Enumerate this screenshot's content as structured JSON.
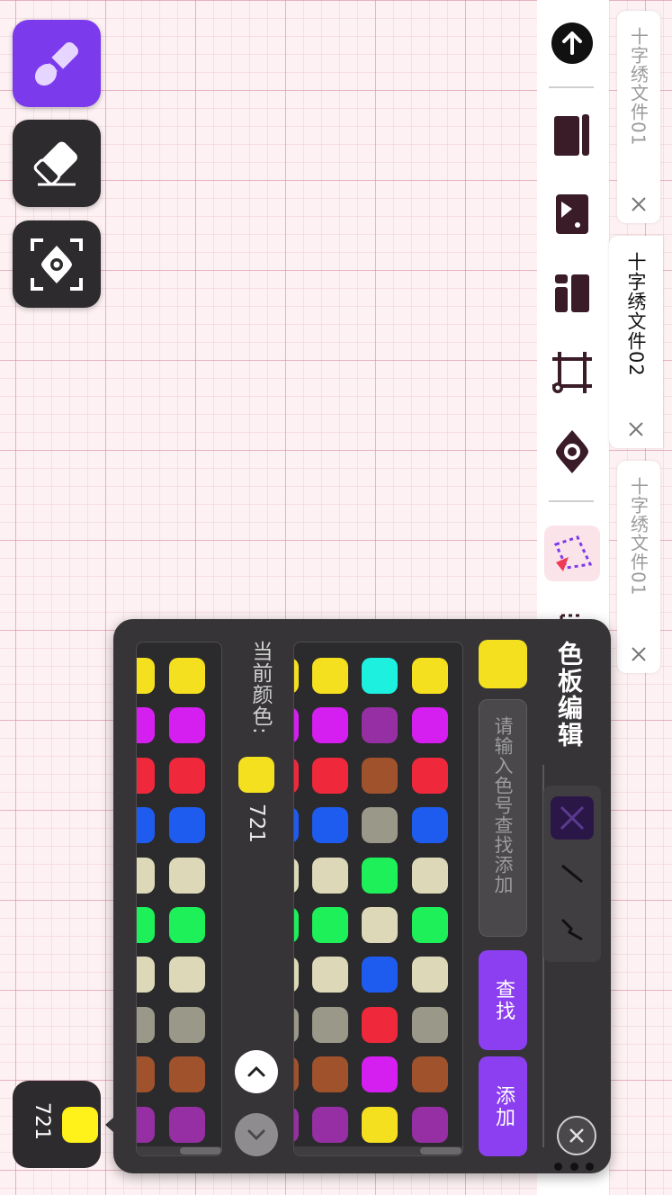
{
  "tabs": [
    {
      "label": "十字绣文件01",
      "active": false
    },
    {
      "label": "十字绣文件02",
      "active": true
    },
    {
      "label": "十字绣文件01",
      "active": false
    }
  ],
  "left_tools": [
    {
      "icon": "pencil-icon",
      "active": true
    },
    {
      "icon": "eraser-icon",
      "active": false
    },
    {
      "icon": "view-focus-icon",
      "active": false
    }
  ],
  "palette_panel": {
    "title": "色板编辑",
    "search_placeholder": "请输入色号查找添加",
    "search_button": "查找",
    "add_button": "添加",
    "current_color_label": "当前颜色:",
    "current_color_code": "721",
    "current_color_hex": "#f5e020"
  },
  "bottom_chip": {
    "code": "721",
    "color": "#fff21a"
  },
  "colors": {
    "accent": "#8b3ff0",
    "panel_bg": "#363437",
    "grid_main": "#dc8ca0",
    "canvas_bg": "#fdf1f3"
  },
  "color_columns": [
    [
      "#f5e020",
      "#d41ff0",
      "#f0283c",
      "#1e5cf0",
      "#ddd9b8",
      "#1ef05a",
      "#ddd9b8",
      "#9a9888",
      "#a0522d",
      "#952fa3",
      "#1ef0e0"
    ],
    [
      "#1ef0e0",
      "#952fa3",
      "#a0522d",
      "#9a9888",
      "#1ef05a",
      "#ddd9b8",
      "#1e5cf0",
      "#f0283c",
      "#d41ff0",
      "#f5e020"
    ]
  ]
}
